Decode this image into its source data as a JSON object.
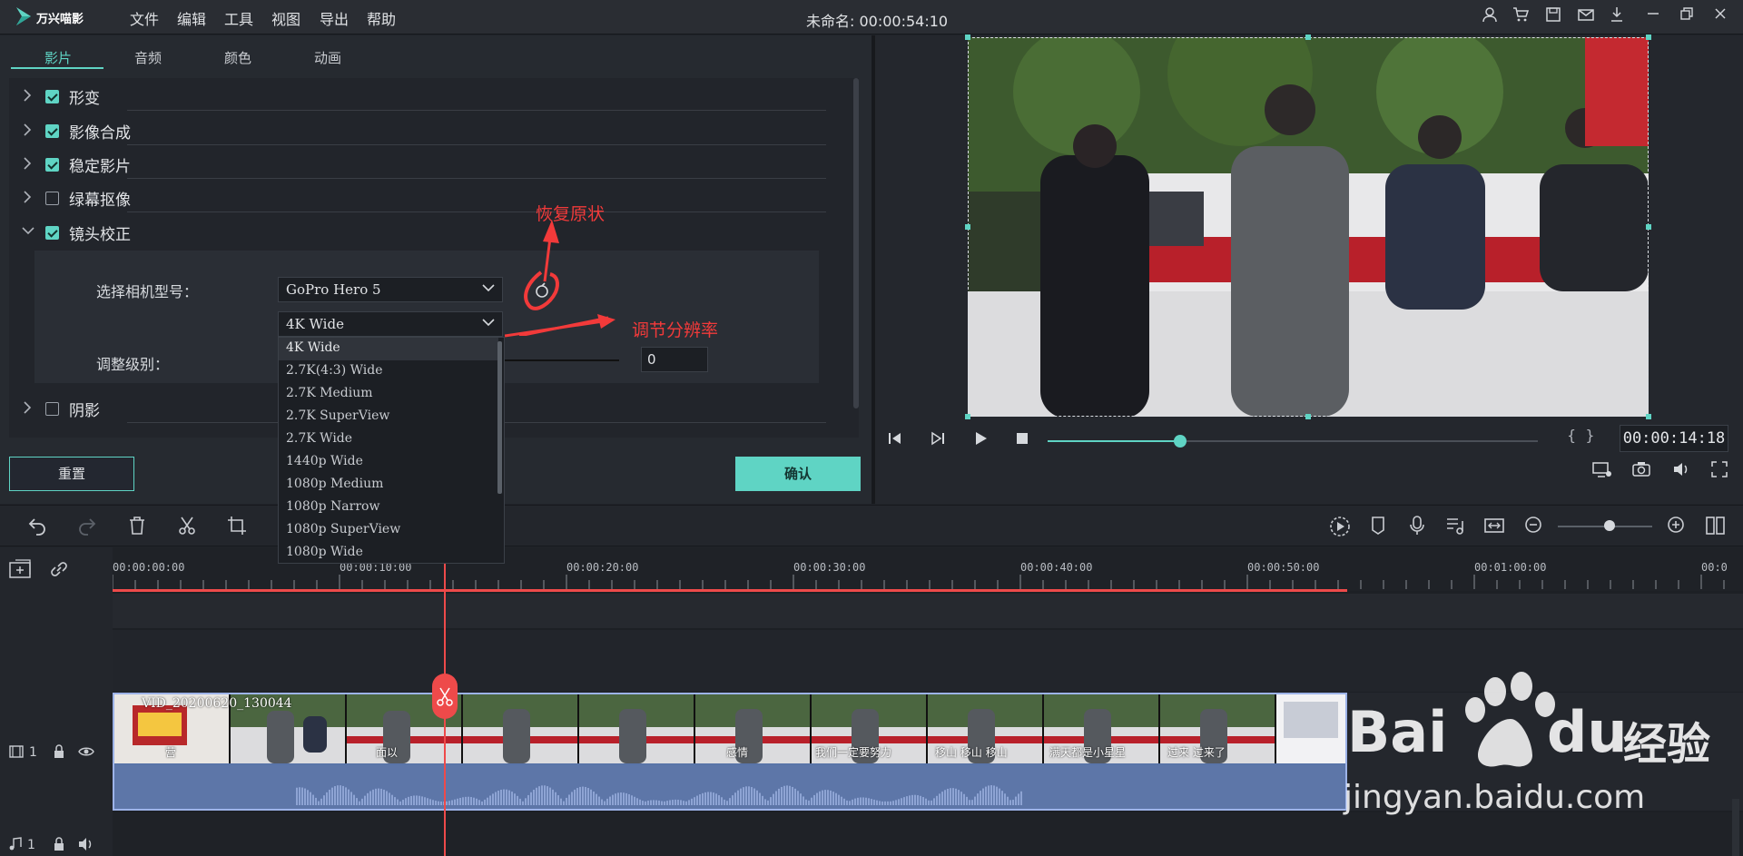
{
  "app": {
    "name": "万兴喵影",
    "doc_title": "未命名: 00:00:54:10"
  },
  "menu": [
    {
      "label": "文件"
    },
    {
      "label": "编辑"
    },
    {
      "label": "工具"
    },
    {
      "label": "视图"
    },
    {
      "label": "导出"
    },
    {
      "label": "帮助"
    }
  ],
  "tabs": [
    {
      "label": "影片"
    },
    {
      "label": "音频"
    },
    {
      "label": "颜色"
    },
    {
      "label": "动画"
    }
  ],
  "properties": [
    {
      "label": "形变",
      "checked": true,
      "expanded": false
    },
    {
      "label": "影像合成",
      "checked": true,
      "expanded": false
    },
    {
      "label": "稳定影片",
      "checked": true,
      "expanded": false
    },
    {
      "label": "绿幕抠像",
      "checked": false,
      "expanded": false
    },
    {
      "label": "镜头校正",
      "checked": true,
      "expanded": true
    },
    {
      "label": "阴影",
      "checked": false,
      "expanded": false
    }
  ],
  "lens": {
    "camera_label": "选择相机型号：",
    "camera_value": "GoPro Hero 5",
    "resolution_value": "4K Wide",
    "level_label": "调整级别：",
    "level_value": "0",
    "resolution_options": [
      "4K Wide",
      "2.7K(4:3) Wide",
      "2.7K Medium",
      "2.7K SuperView",
      "2.7K Wide",
      "1440p Wide",
      "1080p Medium",
      "1080p Narrow",
      "1080p SuperView",
      "1080p Wide"
    ]
  },
  "annotations": {
    "reset": "恢复原状",
    "resolution": "调节分辨率"
  },
  "buttons": {
    "reset": "重置",
    "ok": "确认"
  },
  "preview": {
    "timecode": "00:00:14:18",
    "progress": 0.27
  },
  "timeline": {
    "ruler": [
      "00:00:00:00",
      "00:00:10:00",
      "00:00:20:00",
      "00:00:30:00",
      "00:00:40:00",
      "00:00:50:00",
      "00:01:00:00",
      "00:0"
    ],
    "clip_name": "VID_20200620_130044",
    "captions": [
      "营",
      "面以",
      "感情",
      "我们一定要努力",
      "移山 移山 移山",
      "满天都是小星星",
      "过来 过来了"
    ],
    "video_track": "1",
    "audio_track": "1",
    "zoom": 0.55
  },
  "watermark": {
    "brand": "Bai",
    "du": "du",
    "cn": "经验",
    "url": "jingyan.baidu.com"
  }
}
